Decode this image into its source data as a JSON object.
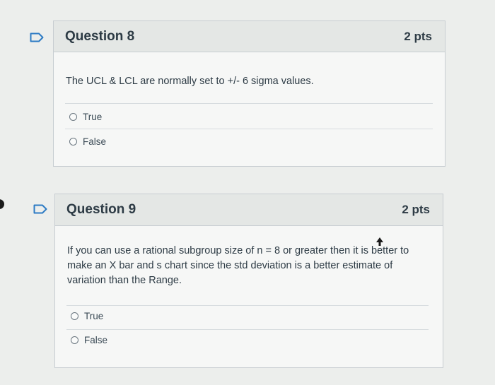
{
  "questions": [
    {
      "title": "Question 8",
      "points": "2 pts",
      "text": "The UCL & LCL are normally set to +/- 6 sigma values.",
      "answers": [
        "True",
        "False"
      ]
    },
    {
      "title": "Question 9",
      "points": "2 pts",
      "text": "If you can use a rational subgroup size of n = 8 or greater then it is better to make an X bar and s chart since the std deviation is a better estimate of variation than the Range.",
      "answers": [
        "True",
        "False"
      ]
    }
  ],
  "icons": {
    "flag": "flag-outline-icon",
    "cursor": "mouse-pointer-icon"
  },
  "colors": {
    "card_border": "#c7cdd1",
    "header_bg": "#e4e7e5",
    "flag_blue": "#2d7bc4"
  }
}
